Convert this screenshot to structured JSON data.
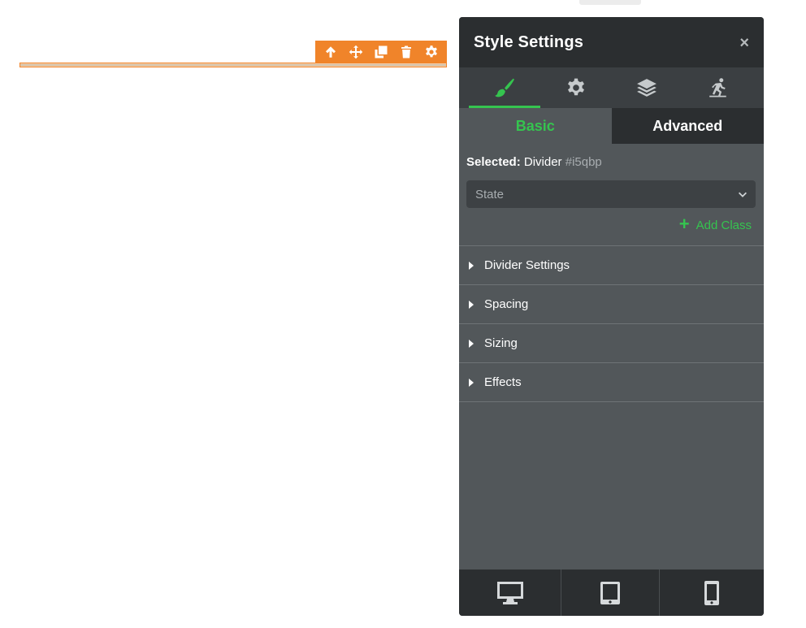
{
  "toolbar": {
    "items": [
      "select-parent",
      "move",
      "clone",
      "delete",
      "settings"
    ]
  },
  "panel": {
    "title": "Style Settings",
    "close_label": "×",
    "tabs": [
      {
        "name": "style-manager",
        "icon": "paint-brush-icon",
        "active": true
      },
      {
        "name": "settings",
        "icon": "gear-icon",
        "active": false
      },
      {
        "name": "layers",
        "icon": "layers-icon",
        "active": false
      },
      {
        "name": "interactions",
        "icon": "animation-icon",
        "active": false
      }
    ],
    "subtabs": {
      "basic": "Basic",
      "advanced": "Advanced"
    },
    "selected": {
      "label": "Selected:",
      "component": "Divider",
      "id": "#i5qbp"
    },
    "state": {
      "value": "State"
    },
    "add_class": {
      "plus": "+",
      "label": "Add Class"
    },
    "sections": [
      {
        "label": "Divider Settings"
      },
      {
        "label": "Spacing"
      },
      {
        "label": "Sizing"
      },
      {
        "label": "Effects"
      }
    ],
    "devices": [
      {
        "name": "desktop",
        "icon": "desktop-icon"
      },
      {
        "name": "tablet",
        "icon": "tablet-icon"
      },
      {
        "name": "mobile",
        "icon": "mobile-icon"
      }
    ]
  },
  "colors": {
    "accent": "#35c44f",
    "toolbar": "#f0842a",
    "panel_bg": "#52575a",
    "panel_dark": "#2b2e30"
  }
}
